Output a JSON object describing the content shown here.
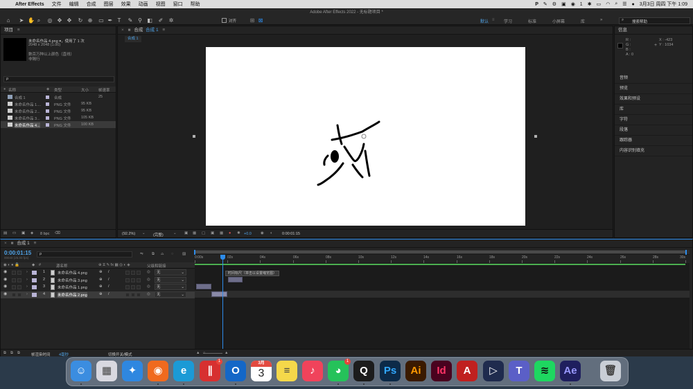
{
  "menubar": {
    "apple": "",
    "app": "After Effects",
    "items": [
      "文件",
      "编辑",
      "合成",
      "图层",
      "效果",
      "动画",
      "视图",
      "窗口",
      "帮助"
    ],
    "status_number": "1",
    "clock": "3月3日 周四 下午 1:09"
  },
  "window_title": "Adobe After Effects 2022 - 无标题项目 *",
  "toolbar": {
    "align_label": "对齐",
    "workspaces": [
      "默认",
      "学习",
      "标准",
      "小屏幕",
      "库"
    ],
    "workspace_more": "»",
    "search_placeholder": "搜索帮助"
  },
  "project": {
    "title": "项目",
    "menu_icon": "≡",
    "selected_name": "未命名作品 4.png ▾，使用了 1 次",
    "selected_dims": "2048 x 2048 (1.00)",
    "selected_color": "数百万种以上颜色（直线）",
    "selected_interlace": "非隔行",
    "search_placeholder": "ρ",
    "columns": [
      "名称",
      "类型",
      "大小",
      "帧速率"
    ],
    "rows": [
      {
        "name": "合成 1",
        "type": "合成",
        "size": "",
        "fps": "25"
      },
      {
        "name": "未命名作品 1....",
        "type": "PNG 文件",
        "size": "95 KB",
        "fps": ""
      },
      {
        "name": "未命名作品 2...",
        "type": "PNG 文件",
        "size": "95 KB",
        "fps": ""
      },
      {
        "name": "未命名作品 3...",
        "type": "PNG 文件",
        "size": "105 KB",
        "fps": ""
      },
      {
        "name": "未命名作品 4...",
        "type": "PNG 文件",
        "size": "100 KB",
        "fps": ""
      }
    ],
    "bpc": "8 bpc"
  },
  "comp_viewer": {
    "tab": "合成 合成 1",
    "tab_prefix": "合成",
    "tab_name": "合成 1",
    "sub_tab": "合成 1",
    "zoom": "(92.2%)",
    "resolution": "(完整)",
    "exposure": "+0.0",
    "timecode": "0:00:01:15"
  },
  "right_panels": {
    "info_title": "信息",
    "rgb": [
      "R :",
      "G :",
      "B :",
      "A : 0"
    ],
    "x": "X : -423",
    "y": "Y : 1034",
    "list": [
      "音频",
      "预览",
      "效果和预设",
      "库",
      "字符",
      "段落",
      "跟踪器",
      "内容识别填充"
    ]
  },
  "timeline": {
    "tab": "合成 1",
    "timecode": "0:00:01:15",
    "fps_sub": "00040 (25.00 fps)",
    "search_placeholder": "ρ",
    "col_source": "源名称",
    "col_parent": "父级和链接",
    "ruler_labels": [
      "0:00s",
      "02s",
      "04s",
      "06s",
      "08s",
      "10s",
      "12s",
      "14s",
      "16s",
      "18s",
      "20s",
      "22s",
      "24s",
      "26s",
      "28s",
      "30s"
    ],
    "tooltip": "时间标尺（单击以设置缩览图）",
    "layers": [
      {
        "num": "1",
        "name": "未命名作品 4.png",
        "parent": "无"
      },
      {
        "num": "2",
        "name": "未命名作品 3.png",
        "parent": "无"
      },
      {
        "num": "3",
        "name": "未命名作品 1.png",
        "parent": "无"
      },
      {
        "num": "4",
        "name": "未命名作品 2.png",
        "parent": "无"
      }
    ],
    "footer_render": "帧渲染时间",
    "footer_ms": "4毫秒",
    "footer_switch": "切换开关/模式"
  },
  "dock": {
    "apps": [
      "Finder",
      "Launchpad",
      "Safari",
      "Firefox",
      "Edge",
      "Parallels",
      "Outlook",
      "Calendar",
      "Notes",
      "Music",
      "WeChat",
      "QQ",
      "Ps",
      "Ai",
      "Id",
      "Acrobat",
      "Toolbox",
      "Teams",
      "Spotify",
      "Ae",
      "Trash"
    ],
    "calendar_month": "3月",
    "calendar_day": "3",
    "badge": "1"
  },
  "colors": {
    "accent": "#2d8ceb",
    "timeline_green": "#4caf50",
    "label_purple": "#b9b4d6"
  }
}
